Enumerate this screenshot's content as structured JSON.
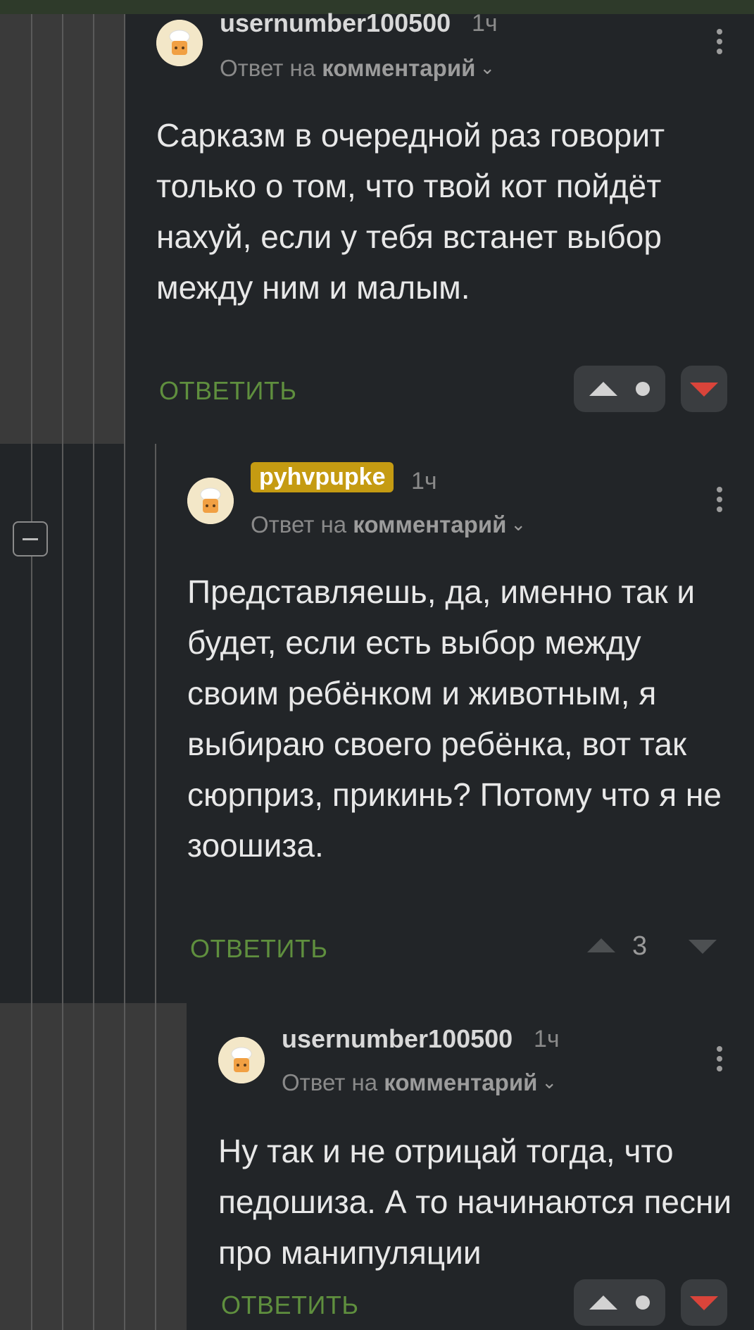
{
  "comments": [
    {
      "author": "usernumber100500",
      "time": "1ч",
      "reply_prefix": "Ответ на",
      "reply_target": "комментарий",
      "body": "Сарказм в очередной раз говорит только о том, что твой кот пойдёт нахуй, если у тебя встанет выбор между ним и малым.",
      "reply_label": "ОТВЕТИТЬ",
      "score": ""
    },
    {
      "author": "pyhvpupke",
      "time": "1ч",
      "reply_prefix": "Ответ на",
      "reply_target": "комментарий",
      "body": "Представляешь, да, именно так и будет, если есть выбор между своим ребёнком и животным, я выбираю своего ребёнка, вот так сюрприз, прикинь? Потому что я не зоошиза.",
      "reply_label": "ОТВЕТИТЬ",
      "score": "3"
    },
    {
      "author": "usernumber100500",
      "time": "1ч",
      "reply_prefix": "Ответ на",
      "reply_target": "комментарий",
      "body": "Ну так и не отрицай тогда, что педошиза. А то начинаются песни про манипуляции",
      "reply_label": "ОТВЕТИТЬ",
      "score": ""
    }
  ],
  "colors": {
    "background": "#222528",
    "reply_green": "#5f8f3e",
    "badge_gold": "#c59b12",
    "downvote_red": "#d9443a"
  },
  "icons": [
    "collapse-thread-icon",
    "kebab-menu-icon",
    "chevron-down-icon",
    "upvote-icon",
    "downvote-icon",
    "avatar-icon"
  ]
}
